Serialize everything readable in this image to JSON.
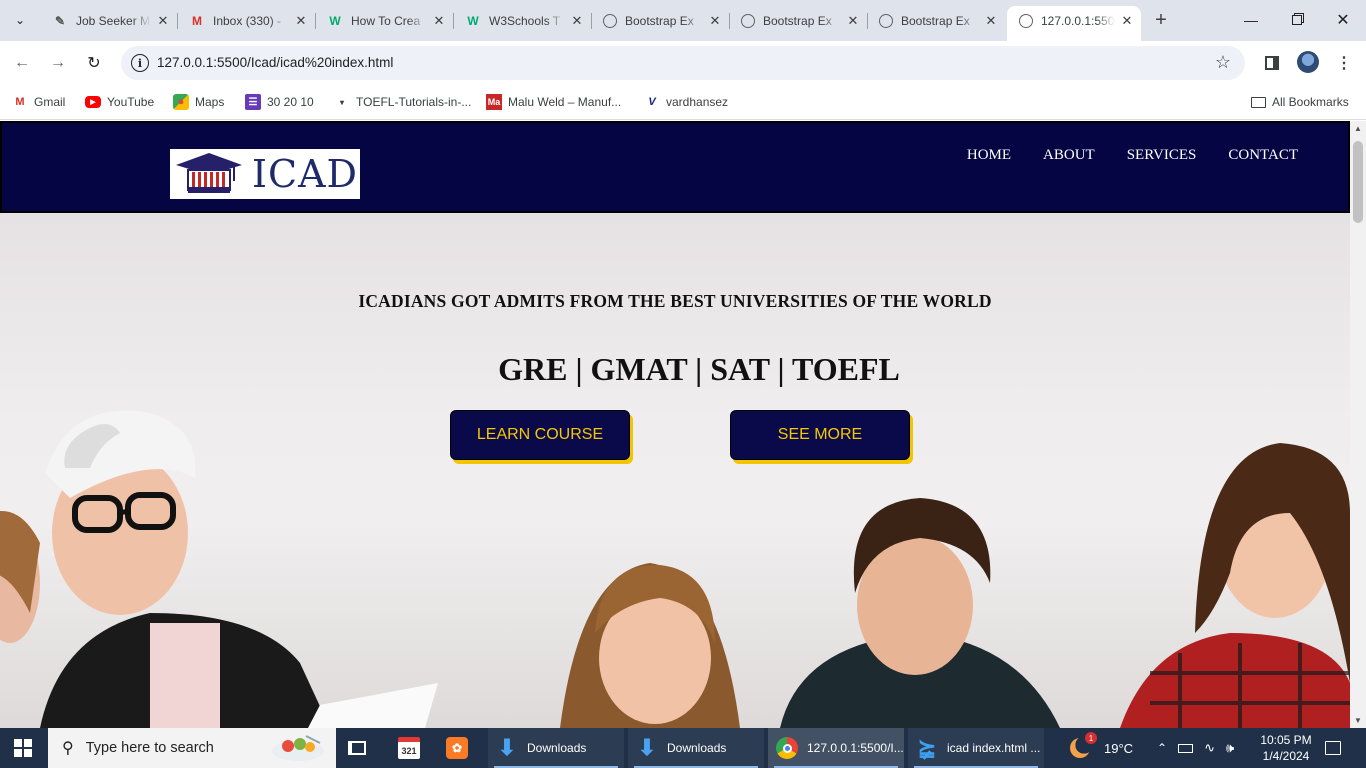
{
  "browser": {
    "tabs": [
      {
        "title": "Job Seeker M",
        "icon": "job-seeker-favicon",
        "active": false
      },
      {
        "title": "Inbox (330) -",
        "icon": "gmail-favicon",
        "active": false
      },
      {
        "title": "How To Crea",
        "icon": "w3schools-favicon",
        "active": false
      },
      {
        "title": "W3Schools T",
        "icon": "w3schools-favicon",
        "active": false
      },
      {
        "title": "Bootstrap Ex",
        "icon": "globe-icon",
        "active": false
      },
      {
        "title": "Bootstrap Ex",
        "icon": "globe-icon",
        "active": false
      },
      {
        "title": "Bootstrap Ex",
        "icon": "globe-icon",
        "active": false
      },
      {
        "title": "127.0.0.1:550",
        "icon": "globe-icon",
        "active": true
      }
    ],
    "url": "127.0.0.1:5500/Icad/icad%20index.html",
    "bookmarks": [
      {
        "label": "Gmail",
        "icon": "gmail-icon"
      },
      {
        "label": "YouTube",
        "icon": "youtube-icon"
      },
      {
        "label": "Maps",
        "icon": "maps-icon"
      },
      {
        "label": "30 20 10",
        "icon": "list-icon"
      },
      {
        "label": "TOEFL-Tutorials-in-...",
        "icon": "dropdown-bookmark-icon"
      },
      {
        "label": "Malu Weld – Manuf...",
        "icon": "maluweld-icon"
      },
      {
        "label": "vardhansez",
        "icon": "v-icon"
      }
    ],
    "all_bookmarks_label": "All Bookmarks"
  },
  "site": {
    "logo_text": "ICAD",
    "nav": [
      "HOME",
      "ABOUT",
      "SERVICES",
      "CONTACT"
    ],
    "hero_subtitle": "ICADIANS GOT ADMITS FROM THE BEST UNIVERSITIES OF THE WORLD",
    "hero_title": "GRE | GMAT | SAT | TOEFL",
    "btn_learn": "LEARN COURSE",
    "btn_more": "SEE MORE",
    "colors": {
      "nav_bg": "#050544",
      "button_bg": "#0a0a4a",
      "button_text": "#f6c800"
    }
  },
  "taskbar": {
    "search_placeholder": "Type here to search",
    "apps": [
      {
        "label": "Downloads",
        "icon": "download-arrow-icon"
      },
      {
        "label": "Downloads",
        "icon": "download-arrow-icon"
      },
      {
        "label": "127.0.0.1:5500/I...",
        "icon": "chrome-icon"
      },
      {
        "label": "icad index.html ...",
        "icon": "vscode-icon"
      }
    ],
    "weather": "19°C",
    "notification_count": "1",
    "time": "10:05 PM",
    "date": "1/4/2024"
  }
}
